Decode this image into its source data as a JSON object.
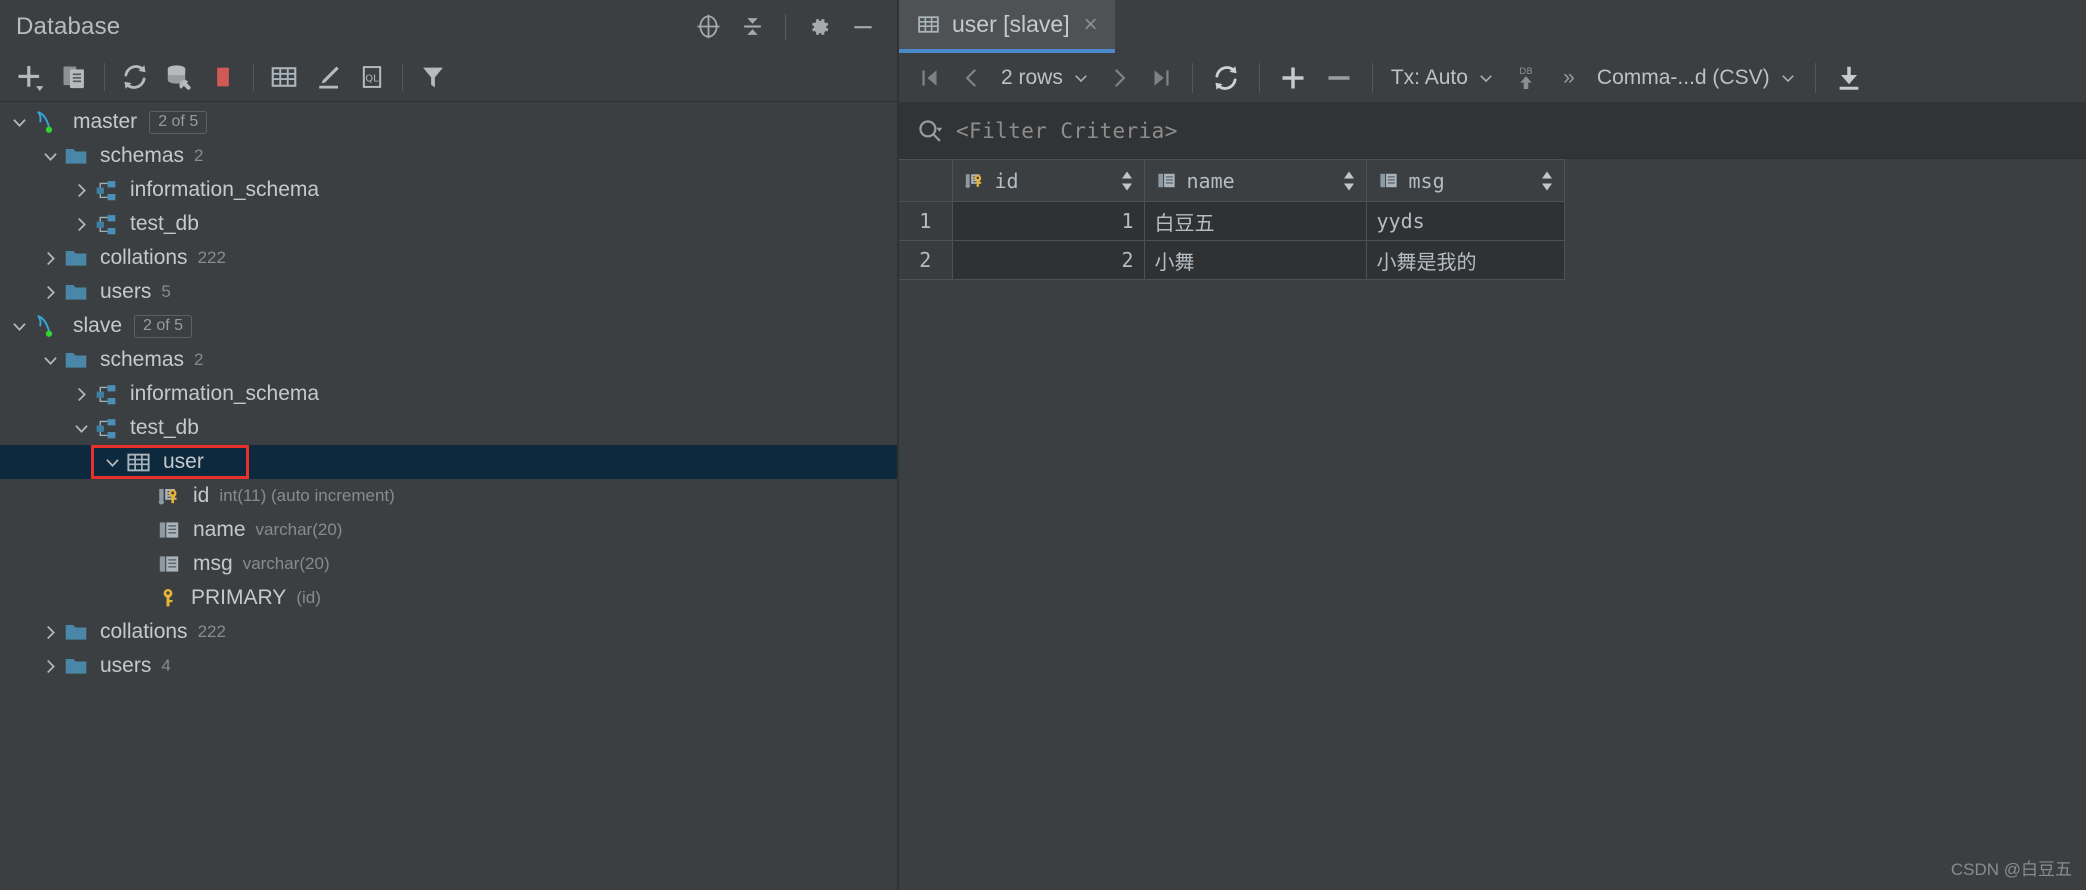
{
  "database_panel": {
    "title": "Database",
    "header_actions": [
      {
        "name": "scroll-from-source-icon",
        "label": "Scroll from Source"
      },
      {
        "name": "collapse-all-icon",
        "label": "Collapse All"
      },
      {
        "name": "gear-icon",
        "label": "Options"
      },
      {
        "name": "minimize-icon",
        "label": "Hide"
      }
    ],
    "toolbar": [
      {
        "name": "add-icon",
        "label": "New"
      },
      {
        "name": "duplicate-icon",
        "label": "Duplicate"
      },
      {
        "name": "refresh-icon",
        "label": "Refresh"
      },
      {
        "name": "database-tools-icon",
        "label": "Database Tools"
      },
      {
        "name": "stop-icon",
        "label": "Stop"
      },
      {
        "name": "table-editor-icon",
        "label": "Table Editor"
      },
      {
        "name": "modify-icon",
        "label": "Modify"
      },
      {
        "name": "query-console-icon",
        "label": "Open Query Console"
      },
      {
        "name": "filter-icon",
        "label": "Filter"
      }
    ],
    "tree": [
      {
        "label": "master",
        "badge": "2 of 5",
        "icon": "mysql-icon",
        "indent": 0,
        "twisty": "expanded"
      },
      {
        "label": "schemas",
        "sub": "2",
        "icon": "folder-icon",
        "indent": 1,
        "twisty": "expanded"
      },
      {
        "label": "information_schema",
        "icon": "schema-icon",
        "indent": 2,
        "twisty": "collapsed"
      },
      {
        "label": "test_db",
        "icon": "schema-icon",
        "indent": 2,
        "twisty": "collapsed"
      },
      {
        "label": "collations",
        "sub": "222",
        "icon": "folder-icon",
        "indent": 1,
        "twisty": "collapsed"
      },
      {
        "label": "users",
        "sub": "5",
        "icon": "folder-icon",
        "indent": 1,
        "twisty": "collapsed"
      },
      {
        "label": "slave",
        "badge": "2 of 5",
        "icon": "mysql-icon",
        "indent": 0,
        "twisty": "expanded"
      },
      {
        "label": "schemas",
        "sub": "2",
        "icon": "folder-icon",
        "indent": 1,
        "twisty": "expanded"
      },
      {
        "label": "information_schema",
        "icon": "schema-icon",
        "indent": 2,
        "twisty": "collapsed"
      },
      {
        "label": "test_db",
        "icon": "schema-icon",
        "indent": 2,
        "twisty": "expanded"
      },
      {
        "label": "user",
        "icon": "table-icon",
        "indent": 3,
        "twisty": "expanded",
        "selected": true,
        "highlighted": true
      },
      {
        "label": "id",
        "sub": "int(11) (auto increment)",
        "icon": "primary-column-icon",
        "indent": 4,
        "twisty": "none"
      },
      {
        "label": "name",
        "sub": "varchar(20)",
        "icon": "column-icon",
        "indent": 4,
        "twisty": "none"
      },
      {
        "label": "msg",
        "sub": "varchar(20)",
        "icon": "column-icon",
        "indent": 4,
        "twisty": "none"
      },
      {
        "label": "PRIMARY",
        "sub": "(id)",
        "icon": "key-icon",
        "indent": 4,
        "twisty": "none"
      },
      {
        "label": "collations",
        "sub": "222",
        "icon": "folder-icon",
        "indent": 1,
        "twisty": "collapsed"
      },
      {
        "label": "users",
        "sub": "4",
        "icon": "folder-icon",
        "indent": 1,
        "twisty": "collapsed"
      }
    ]
  },
  "editor": {
    "tab": {
      "label": "user [slave]",
      "icon": "table-icon",
      "close": "×"
    },
    "toolbar": {
      "first_page": "first-page-icon",
      "prev_page": "prev-page-icon",
      "row_count": "2 rows",
      "next_page": "next-page-icon",
      "last_page": "last-page-icon",
      "reload": "reload-icon",
      "add_row": "add-row-icon",
      "delete_row": "delete-row-icon",
      "tx_label": "Tx: Auto",
      "submit_icon": "db-submit-icon",
      "more": "»",
      "export_format": "Comma-...d (CSV)",
      "download_icon": "download-icon"
    },
    "filter": {
      "icon": "search-icon",
      "placeholder": "<Filter Criteria>"
    },
    "grid": {
      "gutter_header": "",
      "columns": [
        {
          "label": "id",
          "icon": "primary-column-icon",
          "sortable": true
        },
        {
          "label": "name",
          "icon": "column-icon",
          "sortable": true
        },
        {
          "label": "msg",
          "icon": "column-icon",
          "sortable": true
        }
      ],
      "rows": [
        {
          "num": "1",
          "id": "1",
          "name": "白豆五",
          "msg": "yyds"
        },
        {
          "num": "2",
          "id": "2",
          "name": "小舞",
          "msg": "小舞是我的"
        }
      ]
    }
  },
  "watermark": "CSDN @白豆五",
  "colors": {
    "background": "#3c3f41",
    "selection": "#0d293e",
    "annotation": "#e8312b",
    "accent": "#4a88c7",
    "folder": "#4a86a8",
    "key": "#e8b339",
    "status_ok": "#31d432",
    "stop": "#d15a56"
  }
}
